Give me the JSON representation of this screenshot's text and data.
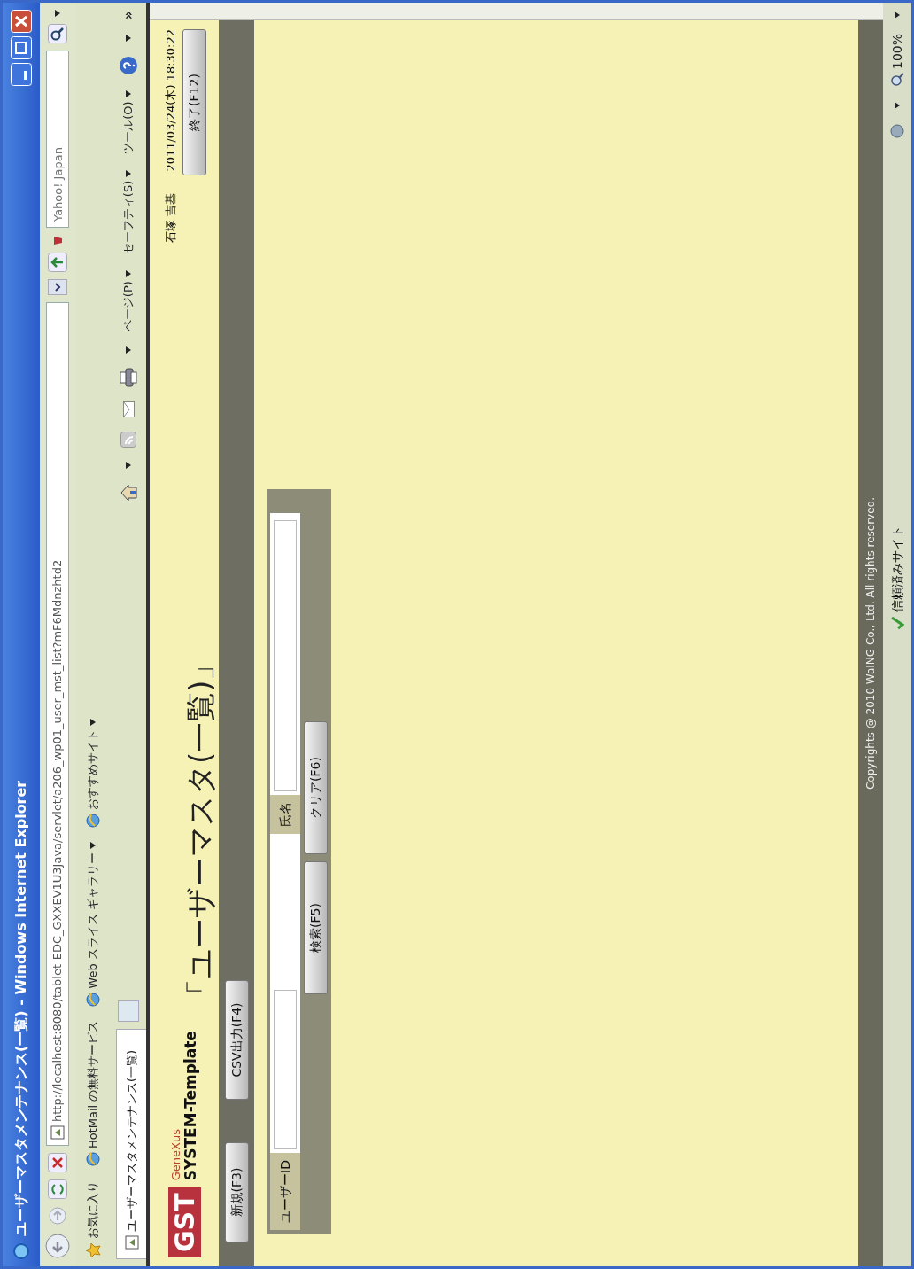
{
  "window": {
    "title": "ユーザーマスタメンテナンス(一覧) - Windows Internet Explorer"
  },
  "address_bar": {
    "url": "http://localhost:8080/tablet-EDC_GXXEV1U3Java/servlet/a206_wp01_user_mst_list?mF6Mdnzhtd2"
  },
  "search_box": {
    "placeholder": "Yahoo! Japan"
  },
  "favorites_bar": {
    "label": "お気に入り",
    "links": [
      {
        "text": "HotMail の無料サービス",
        "dropdown": false
      },
      {
        "text": "Web スライス ギャラリー",
        "dropdown": true
      },
      {
        "text": "おすすめサイト",
        "dropdown": true
      }
    ]
  },
  "tabs": [
    {
      "label": "ユーザーマスタメンテナンス(一覧)",
      "selected": true
    }
  ],
  "command_bar": {
    "menus": [
      "ページ(P)",
      "セーフティ(S)",
      "ツール(O)"
    ],
    "overflow": "»"
  },
  "page": {
    "brand": {
      "logo": "GST",
      "product": "GeneXus",
      "template": "SYSTEM-Template"
    },
    "heading": "「ユーザーマスタ(一覧)」",
    "user": "石塚 吉基",
    "datetime": "2011/03/24(木) 18:30:22",
    "exit_button": "終了(F12)",
    "toolbar_buttons": [
      "新規(F3)",
      "CSV出力(F4)"
    ],
    "search_form": {
      "fields": [
        {
          "label": "ユーザーID"
        },
        {
          "label": "氏名"
        }
      ],
      "buttons": [
        "検索(F5)",
        "クリア(F6)"
      ]
    },
    "footer": "Copyrights @ 2010 WaING Co., Ltd. All rights reserved."
  },
  "status_bar": {
    "zone": "信頼済みサイト",
    "zoom": "100%"
  }
}
